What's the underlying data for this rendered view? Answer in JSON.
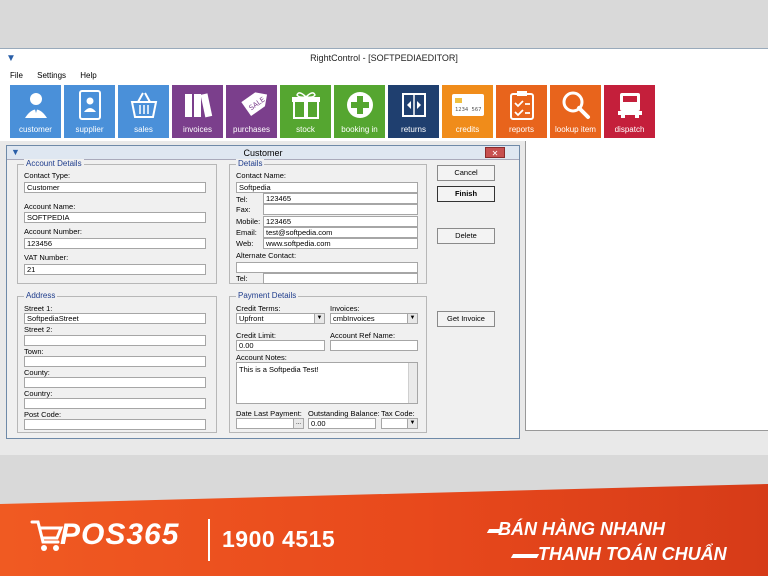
{
  "window": {
    "title": "RightControl - [SOFTPEDIAEDITOR]"
  },
  "menu": [
    "File",
    "Settings",
    "Help"
  ],
  "toolbar": [
    {
      "label": "customer",
      "color": "#4a90d9",
      "icon": "person-icon"
    },
    {
      "label": "supplier",
      "color": "#4a90d9",
      "icon": "address-book-icon"
    },
    {
      "label": "sales",
      "color": "#4a90d9",
      "icon": "basket-icon"
    },
    {
      "label": "invoices",
      "color": "#7b3f8c",
      "icon": "binders-icon"
    },
    {
      "label": "purchases",
      "color": "#7b3f8c",
      "icon": "sale-tag-icon"
    },
    {
      "label": "stock",
      "color": "#55a630",
      "icon": "gift-box-icon"
    },
    {
      "label": "booking in",
      "color": "#55a630",
      "icon": "plus-circle-icon"
    },
    {
      "label": "returns",
      "color": "#1f3f6f",
      "icon": "return-box-icon"
    },
    {
      "label": "credits",
      "color": "#f08c1a",
      "icon": "credit-card-icon"
    },
    {
      "label": "reports",
      "color": "#e8641c",
      "icon": "clipboard-icon"
    },
    {
      "label": "lookup item",
      "color": "#e8641c",
      "icon": "magnifier-icon"
    },
    {
      "label": "dispatch",
      "color": "#c41f3b",
      "icon": "truck-icon"
    }
  ],
  "dialog": {
    "title": "Customer",
    "close": "✕",
    "account": {
      "legend": "Account Details",
      "contact_type_label": "Contact Type:",
      "contact_type": "Customer",
      "account_name_label": "Account Name:",
      "account_name": "SOFTPEDIA",
      "account_number_label": "Account Number:",
      "account_number": "123456",
      "vat_label": "VAT Number:",
      "vat": "21"
    },
    "details": {
      "legend": "Details",
      "contact_name_label": "Contact Name:",
      "contact_name": "Softpedia",
      "tel_label": "Tel:",
      "tel": "123465",
      "fax_label": "Fax:",
      "fax": "",
      "mobile_label": "Mobile:",
      "mobile": "123465",
      "email_label": "Email:",
      "email": "test@softpedia.com",
      "web_label": "Web:",
      "web": "www.softpedia.com",
      "alt_contact_label": "Alternate Contact:",
      "alt_contact": "",
      "alt_tel_label": "Tel:",
      "alt_tel": ""
    },
    "address": {
      "legend": "Address",
      "street1_label": "Street 1:",
      "street1": "SoftpediaStreet",
      "street2_label": "Street 2:",
      "street2": "",
      "town_label": "Town:",
      "town": "",
      "county_label": "County:",
      "county": "",
      "country_label": "Country:",
      "country": "",
      "postcode_label": "Post Code:",
      "postcode": ""
    },
    "payment": {
      "legend": "Payment Details",
      "credit_terms_label": "Credit Terms:",
      "credit_terms": "Upfront",
      "invoices_label": "Invoices:",
      "invoices": "cmbInvoices",
      "credit_limit_label": "Credit Limit:",
      "credit_limit": "0.00",
      "ref_name_label": "Account Ref Name:",
      "ref_name": "",
      "notes_label": "Account Notes:",
      "notes": "This is a Softpedia Test!",
      "last_payment_label": "Date Last Payment:",
      "last_payment": "",
      "outstanding_label": "Outstanding Balance:",
      "outstanding": "0.00",
      "tax_code_label": "Tax Code:",
      "tax_code": ""
    },
    "buttons": {
      "cancel": "Cancel",
      "finish": "Finish",
      "delete": "Delete",
      "get_invoice": "Get Invoice",
      "ellipsis": "...",
      "arrow": "▼"
    }
  },
  "banner": {
    "logo": "POS365",
    "phone": "1900 4515",
    "slogan1": "BÁN HÀNG NHANH",
    "slogan2": "THANH TOÁN CHUẨN"
  }
}
